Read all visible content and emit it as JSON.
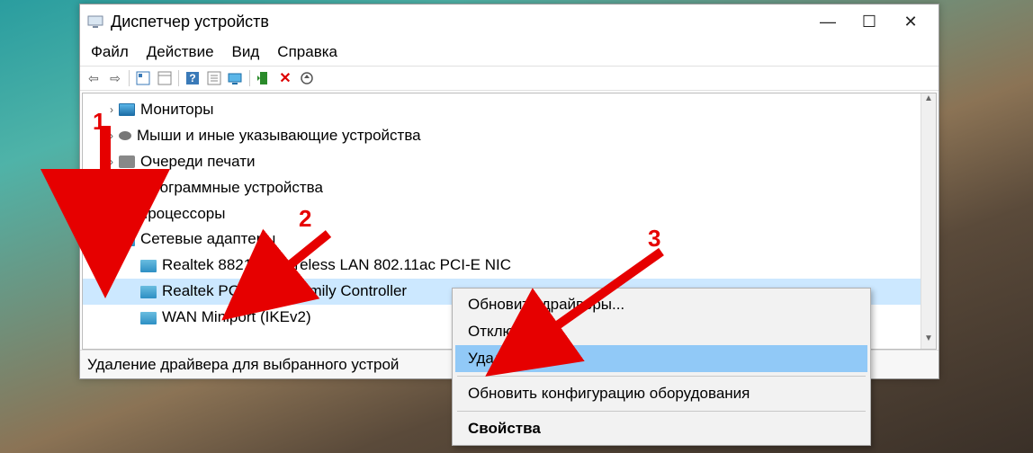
{
  "window": {
    "title": "Диспетчер устройств",
    "min": "—",
    "max": "☐",
    "close": "✕"
  },
  "menu": {
    "file": "Файл",
    "action": "Действие",
    "view": "Вид",
    "help": "Справка"
  },
  "tree": {
    "monitors": "Мониторы",
    "mice": "Мыши и иные указывающие устройства",
    "printq": "Очереди печати",
    "soft": "Программные устройства",
    "cpu": "Процессоры",
    "netadapters": "Сетевые адаптеры",
    "net1": "Realtek 8821AE Wireless LAN 802.11ac PCI-E NIC",
    "net2": "Realtek PCIe GbE Family Controller",
    "net3": "WAN Miniport (IKEv2)"
  },
  "status": "Удаление драйвера для выбранного устрой",
  "ctx": {
    "update": "Обновить драйверы...",
    "disable": "Отключить",
    "delete": "Удалить",
    "rescan": "Обновить конфигурацию оборудования",
    "props": "Свойства"
  },
  "ann": {
    "n1": "1",
    "n2": "2",
    "n3": "3"
  }
}
